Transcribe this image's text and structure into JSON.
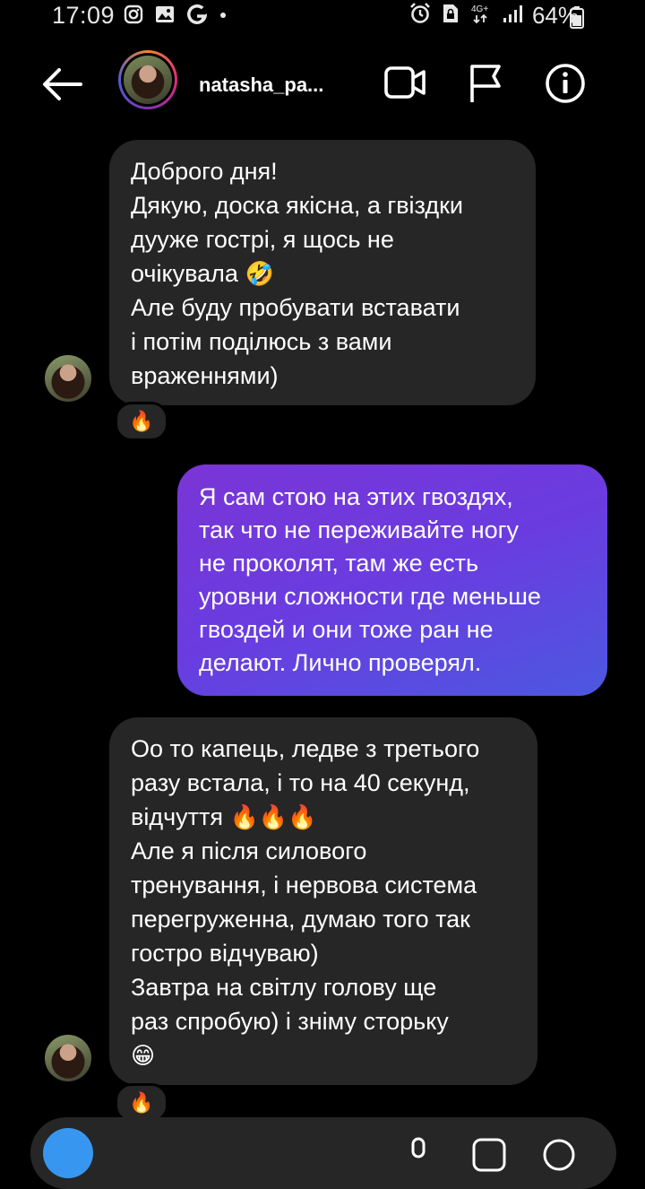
{
  "status": {
    "time": "17:09",
    "network": "4G+",
    "battery": "64%"
  },
  "header": {
    "username": "natasha_pa..."
  },
  "messages": {
    "m1": {
      "lines": [
        "Доброго дня!",
        "Дякую, доска якісна, а гвіздки",
        "дууже гострі, я щось не",
        "очікувала",
        "Але буду пробувати вставати",
        "і потім поділюсь з вами",
        "враженнями)"
      ],
      "emoji_after_line3": "🤣",
      "reaction": "🔥"
    },
    "m2": {
      "lines": [
        "Я сам стою на этих гвоздях,",
        "так что не переживайте ногу",
        "не проколят, там же есть",
        "уровни сложности где меньше",
        "гвоздей и они тоже ран не",
        "делают. Лично проверял."
      ]
    },
    "m3": {
      "lines": [
        "Оо то капець, ледве з третього",
        "разу встала, і то на 40 секунд,",
        "відчуття",
        "Але я після силового",
        "тренування, і нервова система",
        "перегруженна, думаю того так",
        "гостро відчуваю)",
        "Завтра на світлу голову ще",
        "раз спробую) і зніму сторьку"
      ],
      "emoji_after_line2": "🔥🔥🔥",
      "emoji_last": "😁",
      "reaction": "🔥"
    }
  },
  "colors": {
    "incoming_bubble": "#262626",
    "outgoing_gradient_start": "#7a35d6",
    "outgoing_gradient_end": "#4c58e0",
    "background": "#000000"
  },
  "icons": {
    "back": "arrow-left-icon",
    "video": "video-call-icon",
    "flag": "flag-icon",
    "info": "info-icon"
  }
}
